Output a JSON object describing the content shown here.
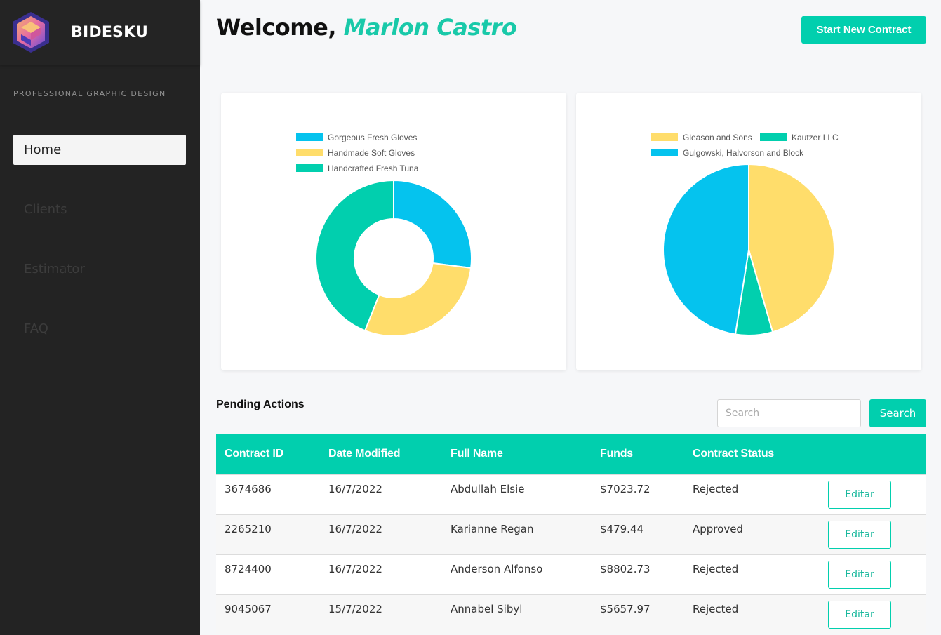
{
  "sidebar": {
    "brand": "BIDESKU",
    "tagline": "PROFESSIONAL GRAPHIC DESIGN",
    "items": [
      {
        "label": "Home",
        "active": true
      },
      {
        "label": "Clients",
        "active": false
      },
      {
        "label": "Estimator",
        "active": false
      },
      {
        "label": "FAQ",
        "active": false
      }
    ]
  },
  "header": {
    "welcome": "Welcome,",
    "user_name": "Marlon Castro",
    "start_button": "Start New Contract"
  },
  "chart_data": [
    {
      "type": "pie",
      "variant": "doughnut",
      "categories": [
        "Gorgeous Fresh Gloves",
        "Handmade Soft Gloves",
        "Handcrafted Fresh Tuna"
      ],
      "values": [
        27,
        29,
        44
      ],
      "colors": [
        "#05c3ee",
        "#ffdd6b",
        "#01cfae"
      ],
      "legend": "top"
    },
    {
      "type": "pie",
      "categories": [
        "Gleason and Sons",
        "Kautzer LLC",
        "Gulgowski, Halvorson and Block"
      ],
      "values": [
        45.5,
        7,
        47.5
      ],
      "colors": [
        "#ffdd6b",
        "#01cfae",
        "#05c3ee"
      ],
      "legend": "top"
    }
  ],
  "pending": {
    "title": "Pending Actions",
    "search_placeholder": "Search",
    "search_button": "Search",
    "columns": [
      "Contract ID",
      "Date Modified",
      "Full Name",
      "Funds",
      "Contract Status",
      ""
    ],
    "edit_label": "Editar",
    "rows": [
      {
        "id": "3674686",
        "date": "16/7/2022",
        "name": "Abdullah Elsie",
        "funds": "$7023.72",
        "status": "Rejected"
      },
      {
        "id": "2265210",
        "date": "16/7/2022",
        "name": "Karianne Regan",
        "funds": "$479.44",
        "status": "Approved"
      },
      {
        "id": "8724400",
        "date": "16/7/2022",
        "name": "Anderson Alfonso",
        "funds": "$8802.73",
        "status": "Rejected"
      },
      {
        "id": "9045067",
        "date": "15/7/2022",
        "name": "Annabel Sibyl",
        "funds": "$5657.97",
        "status": "Rejected"
      }
    ]
  }
}
